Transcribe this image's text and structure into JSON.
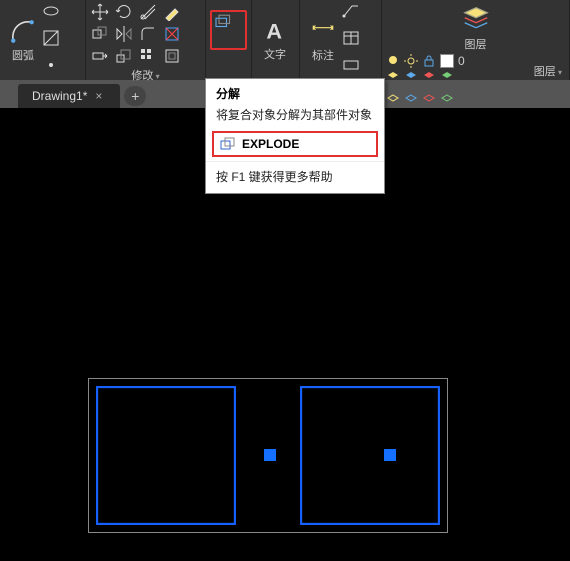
{
  "ribbon": {
    "arc_label": "圆弧",
    "modify_label": "修改",
    "text_label": "文字",
    "annotate_label": "标注",
    "layer_label": "图层",
    "layers_dropdown_label": "图层",
    "layer_zero": "0"
  },
  "tooltip": {
    "title": "分解",
    "desc": "将复合对象分解为其部件对象",
    "command": "EXPLODE",
    "help": "按 F1 键获得更多帮助"
  },
  "tabs": {
    "doc1": "Drawing1*"
  }
}
